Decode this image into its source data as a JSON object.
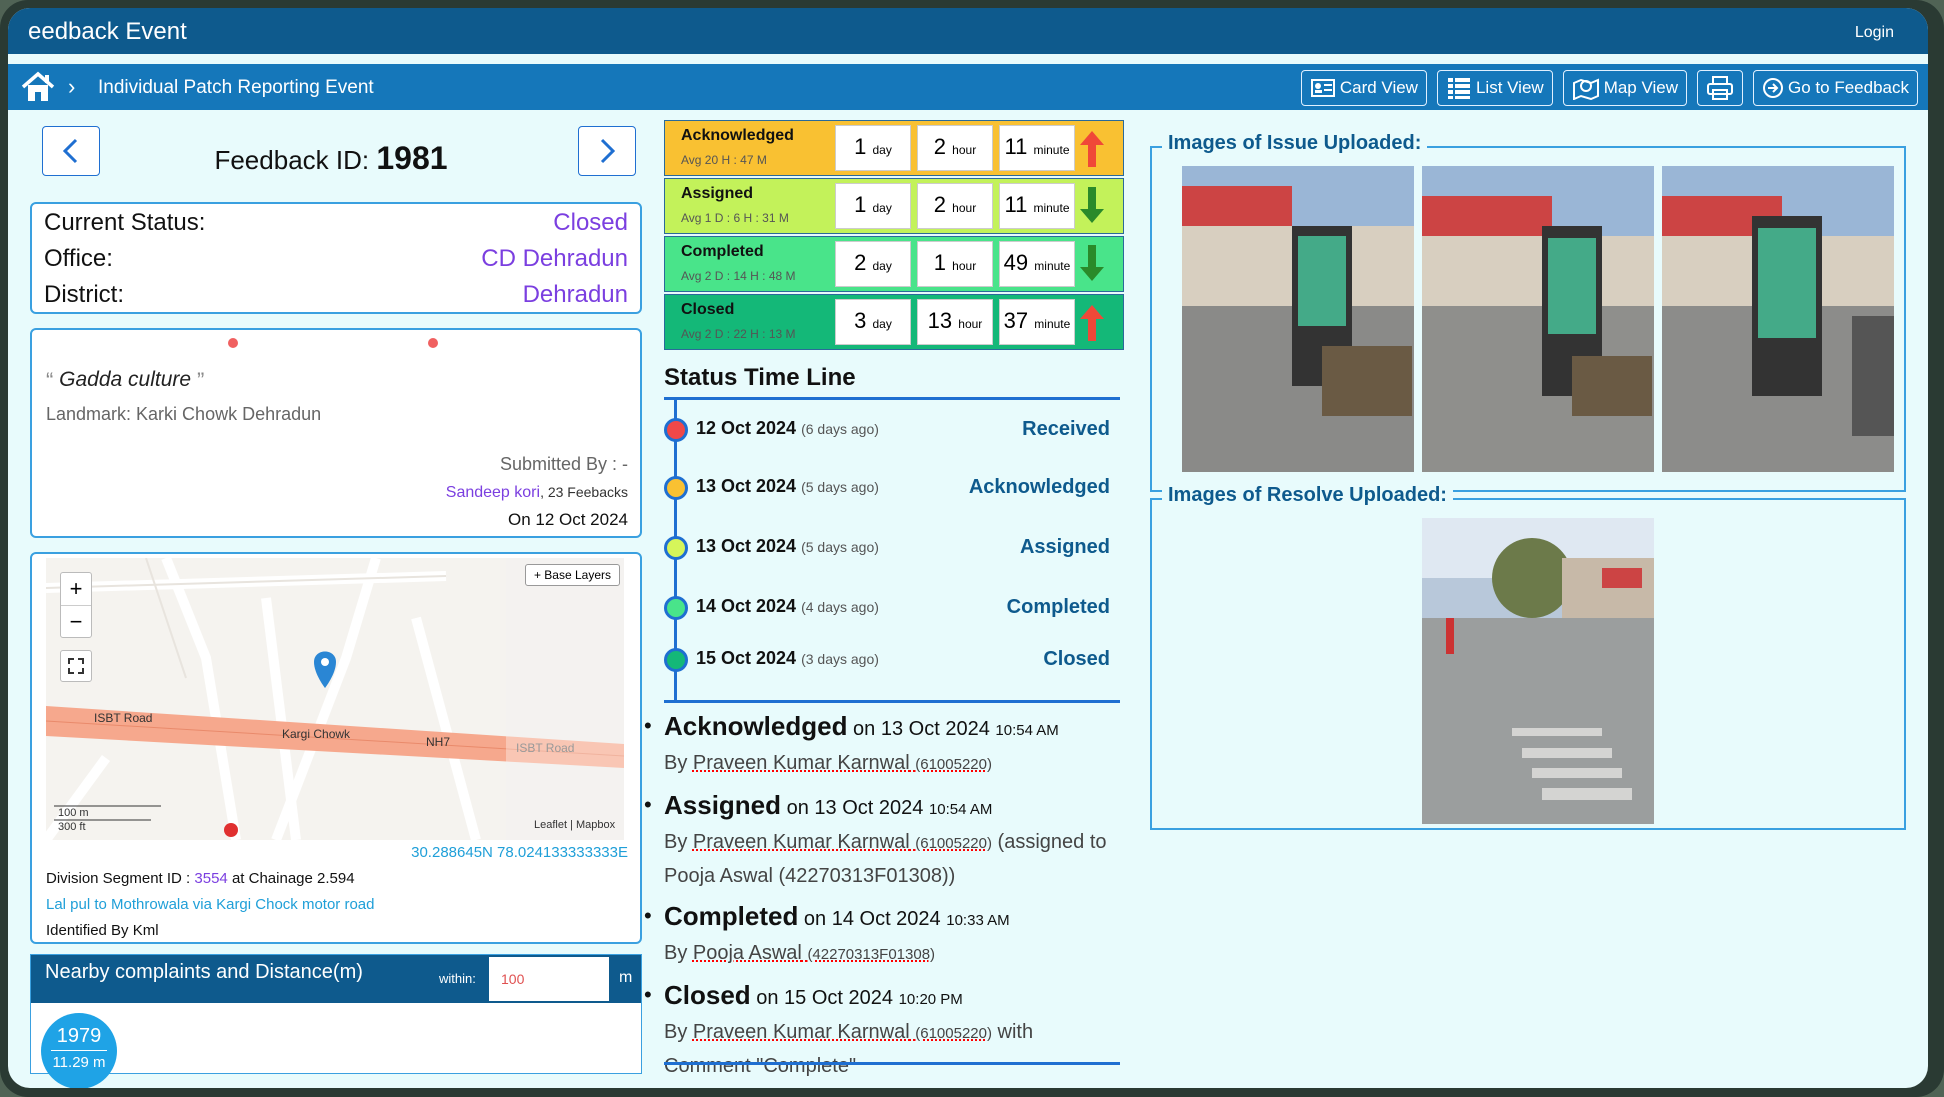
{
  "app": {
    "title": "eedback Event",
    "login": "Login"
  },
  "nav": {
    "crumb": "Individual Patch Reporting Event",
    "buttons": [
      "Card View",
      "List View",
      "Map View",
      "",
      "Go to Feedback"
    ]
  },
  "feedback": {
    "id_label": "Feedback ID:",
    "id": "1981"
  },
  "status": [
    {
      "k": "Current Status:",
      "v": "Closed"
    },
    {
      "k": "Office:",
      "v": "CD Dehradun"
    },
    {
      "k": "District:",
      "v": "Dehradun"
    }
  ],
  "complaint": {
    "text": "Gadda culture",
    "landmark": "Landmark: Karki Chowk Dehradun",
    "submitted": "Submitted By : -",
    "user": "Sandeep kori",
    "count": ", 23 Feebacks",
    "on": "On 12 Oct 2024"
  },
  "map": {
    "base_layers": "+ Base Layers",
    "coords": "30.288645N 78.024133333333E",
    "seg_label": "Division Segment ID :",
    "seg_id": "3554",
    "seg_chain": "at Chainage 2.594",
    "road": "Lal pul to Mothrowala via Kargi Chock motor road",
    "identified": "Identified By Kml",
    "labels": [
      "ISBT Road",
      "Kargi Chowk",
      "NH7",
      "ISBT Road"
    ],
    "scale": [
      "100 m",
      "300 ft"
    ],
    "attrib": "Leaflet | Mapbox"
  },
  "nearby": {
    "title": "Nearby complaints and Distance(m)",
    "within": "within:",
    "value": "100",
    "unit": "m",
    "items": [
      {
        "id": "1979",
        "dist": "11.29 m"
      }
    ]
  },
  "times": [
    {
      "label": "Acknowledged",
      "avg": "Avg 20 H : 47 M",
      "d": "1",
      "h": "2",
      "m": "11",
      "dir": "up",
      "color": "#f9c132"
    },
    {
      "label": "Assigned",
      "avg": "Avg 1 D : 6 H : 31 M",
      "d": "1",
      "h": "2",
      "m": "11",
      "dir": "down",
      "color": "#c3f25a"
    },
    {
      "label": "Completed",
      "avg": "Avg 2 D : 14 H : 48 M",
      "d": "2",
      "h": "1",
      "m": "49",
      "dir": "down",
      "color": "#49e48a"
    },
    {
      "label": "Closed",
      "avg": "Avg 2 D : 22 H : 13 M",
      "d": "3",
      "h": "13",
      "m": "37",
      "dir": "up",
      "color": "#14b878"
    }
  ],
  "units": {
    "day": "day",
    "hour": "hour",
    "minute": "minute"
  },
  "timeline": {
    "title": "Status Time Line",
    "items": [
      {
        "date": "12 Oct 2024",
        "ago": "(6 days ago)",
        "status": "Received",
        "color": "#f04848"
      },
      {
        "date": "13 Oct 2024",
        "ago": "(5 days ago)",
        "status": "Acknowledged",
        "color": "#f9c132"
      },
      {
        "date": "13 Oct 2024",
        "ago": "(5 days ago)",
        "status": "Assigned",
        "color": "#d6f55a"
      },
      {
        "date": "14 Oct 2024",
        "ago": "(4 days ago)",
        "status": "Completed",
        "color": "#49e48a"
      },
      {
        "date": "15 Oct 2024",
        "ago": "(3 days ago)",
        "status": "Closed",
        "color": "#14b878"
      }
    ]
  },
  "logs": [
    {
      "ev": "Acknowledged",
      "on": "on 13 Oct 2024",
      "time": "10:54 AM",
      "by": "Praveen Kumar Karnwal",
      "uid": "(61005220)",
      "extra": ""
    },
    {
      "ev": "Assigned",
      "on": "on 13 Oct 2024",
      "time": "10:54 AM",
      "by": "Praveen Kumar Karnwal",
      "uid": "(61005220)",
      "extra": "(assigned to Pooja Aswal (42270313F01308))"
    },
    {
      "ev": "Completed",
      "on": "on 14 Oct 2024",
      "time": "10:33 AM",
      "by": "Pooja Aswal",
      "uid": "(42270313F01308)",
      "extra": ""
    },
    {
      "ev": "Closed",
      "on": "on 15 Oct 2024",
      "time": "10:20 PM",
      "by": "Praveen Kumar Karnwal",
      "uid": "(61005220)",
      "extra": "with Comment \"Complete\""
    }
  ],
  "by_prefix": "By",
  "images": {
    "issue_title": "Images of Issue Uploaded:",
    "resolve_title": "Images of Resolve Uploaded:"
  }
}
